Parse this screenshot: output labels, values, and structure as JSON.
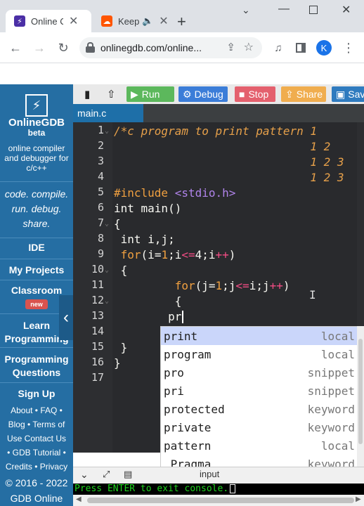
{
  "browser": {
    "tabs": [
      {
        "label": "Online C",
        "active": true
      },
      {
        "label": "Keep",
        "active": false
      }
    ],
    "url": "onlinegdb.com/online...",
    "profile_initial": "K"
  },
  "sidebar": {
    "brand": "OnlineGDB",
    "beta": "beta",
    "tagline": "online compiler and debugger for c/c++",
    "motto": "code. compile. run. debug. share.",
    "nav": [
      {
        "label": "IDE"
      },
      {
        "label": "My Projects"
      },
      {
        "label": "Classroom",
        "badge": "new"
      },
      {
        "label": "Learn Programming"
      },
      {
        "label": "Programming Questions"
      },
      {
        "label": "Sign Up"
      }
    ],
    "footer_links": [
      "About",
      "FAQ",
      "Blog",
      "Terms of Use",
      "Contact Us",
      "GDB Tutorial",
      "Credits",
      "Privacy"
    ],
    "copyright": "© 2016 - 2022 GDB Online"
  },
  "editor_toolbar": {
    "run": "Run",
    "debug": "Debug",
    "stop": "Stop",
    "share": "Share",
    "save": "Save"
  },
  "file_tab": "main.c",
  "code_lines": [
    {
      "n": "1",
      "text": "/*c program to print pattern 1"
    },
    {
      "n": "2",
      "text": "                             1 2"
    },
    {
      "n": "3",
      "text": "                             1 2 3"
    },
    {
      "n": "4",
      "text": "                             1 2 3"
    },
    {
      "n": "5",
      "text": "#include <stdio.h>"
    },
    {
      "n": "6",
      "text": "int main()"
    },
    {
      "n": "7",
      "text": "{"
    },
    {
      "n": "8",
      "text": " int i,j;"
    },
    {
      "n": "9",
      "text": " for(i=1;i<=4;i++)"
    },
    {
      "n": "10",
      "text": " {"
    },
    {
      "n": "11",
      "text": "         for(j=1;j<=i;j++)"
    },
    {
      "n": "12",
      "text": "         {"
    },
    {
      "n": "13",
      "text": "        pr"
    },
    {
      "n": "14",
      "text": ""
    },
    {
      "n": "15",
      "text": " }"
    },
    {
      "n": "16",
      "text": "}"
    },
    {
      "n": "17",
      "text": ""
    }
  ],
  "autocomplete": [
    {
      "word": "print",
      "meta": "local",
      "selected": true
    },
    {
      "word": "program",
      "meta": "local"
    },
    {
      "word": "pro",
      "meta": "snippet"
    },
    {
      "word": "pri",
      "meta": "snippet"
    },
    {
      "word": "protected",
      "meta": "keyword"
    },
    {
      "word": "private",
      "meta": "keyword"
    },
    {
      "word": "pattern",
      "meta": "local"
    },
    {
      "word": "_Pragma",
      "meta": "keyword"
    }
  ],
  "console": {
    "tab_label": "input",
    "message": "Press ENTER to exit console."
  },
  "colors": {
    "sidebar_bg": "#256ea3",
    "editor_bg": "#292a2d",
    "run_btn": "#5cb85c",
    "debug_btn": "#3b7dd8",
    "stop_btn": "#e4606d",
    "share_btn": "#f0ad4e",
    "save_btn": "#2f7bbf"
  }
}
